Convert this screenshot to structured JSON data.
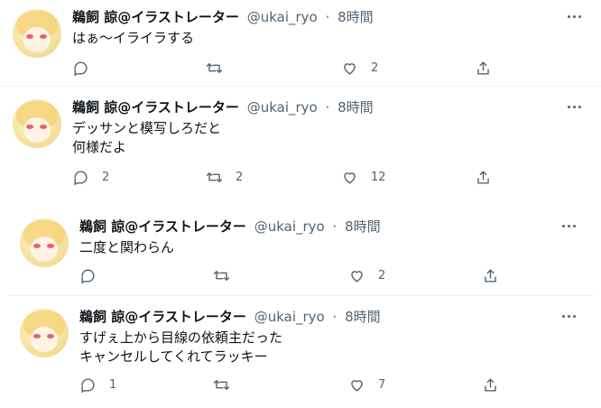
{
  "tweets": [
    {
      "name": "鵜飼 諒@イラストレーター",
      "handle": "@ukai_ryo",
      "time": "8時間",
      "text": "はぁ〜イライラする",
      "reply_count": "",
      "retweet_count": "",
      "like_count": "2"
    },
    {
      "name": "鵜飼 諒@イラストレーター",
      "handle": "@ukai_ryo",
      "time": "8時間",
      "text": "デッサンと模写しろだと\n何様だよ",
      "reply_count": "2",
      "retweet_count": "2",
      "like_count": "12"
    },
    {
      "name": "鵜飼 諒@イラストレーター",
      "handle": "@ukai_ryo",
      "time": "8時間",
      "text": "二度と関わらん",
      "reply_count": "",
      "retweet_count": "",
      "like_count": "2"
    },
    {
      "name": "鵜飼 諒@イラストレーター",
      "handle": "@ukai_ryo",
      "time": "8時間",
      "text": "すげぇ上から目線の依頼主だった\nキャンセルしてくれてラッキー",
      "reply_count": "1",
      "retweet_count": "",
      "like_count": "7"
    }
  ],
  "icons": [
    "more-icon",
    "reply-icon",
    "retweet-icon",
    "like-icon",
    "share-icon"
  ],
  "colors": {
    "text": "#0f1419",
    "secondary": "#536471",
    "divider": "#eff3f4"
  }
}
